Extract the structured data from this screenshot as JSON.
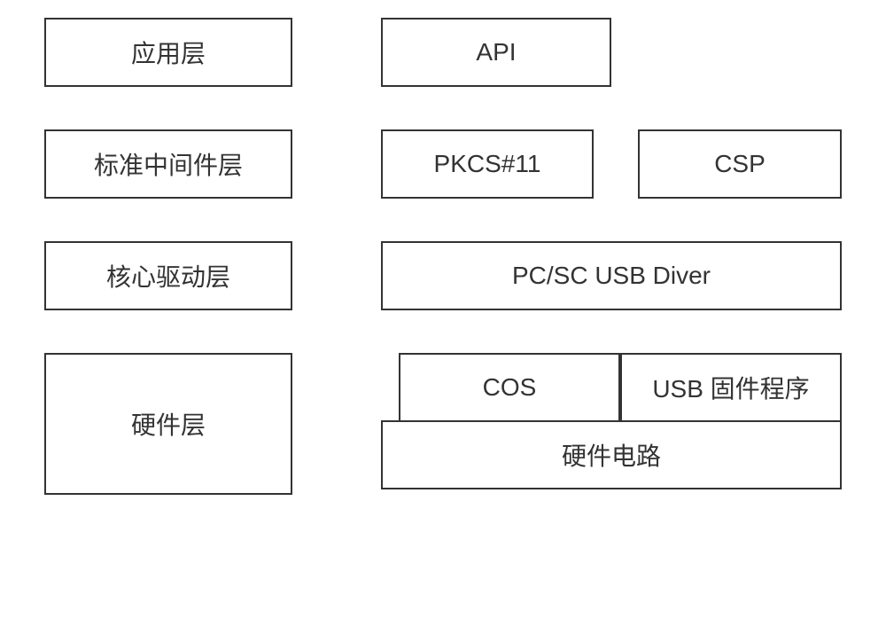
{
  "rows": [
    {
      "label": "应用层",
      "items": [
        "API"
      ]
    },
    {
      "label": "标准中间件层",
      "items": [
        "PKCS#11",
        "CSP"
      ]
    },
    {
      "label": "核心驱动层",
      "items": [
        "PC/SC USB Diver"
      ]
    },
    {
      "label": "硬件层",
      "top_items": [
        "COS",
        "USB 固件程序"
      ],
      "bottom_item": "硬件电路"
    }
  ]
}
